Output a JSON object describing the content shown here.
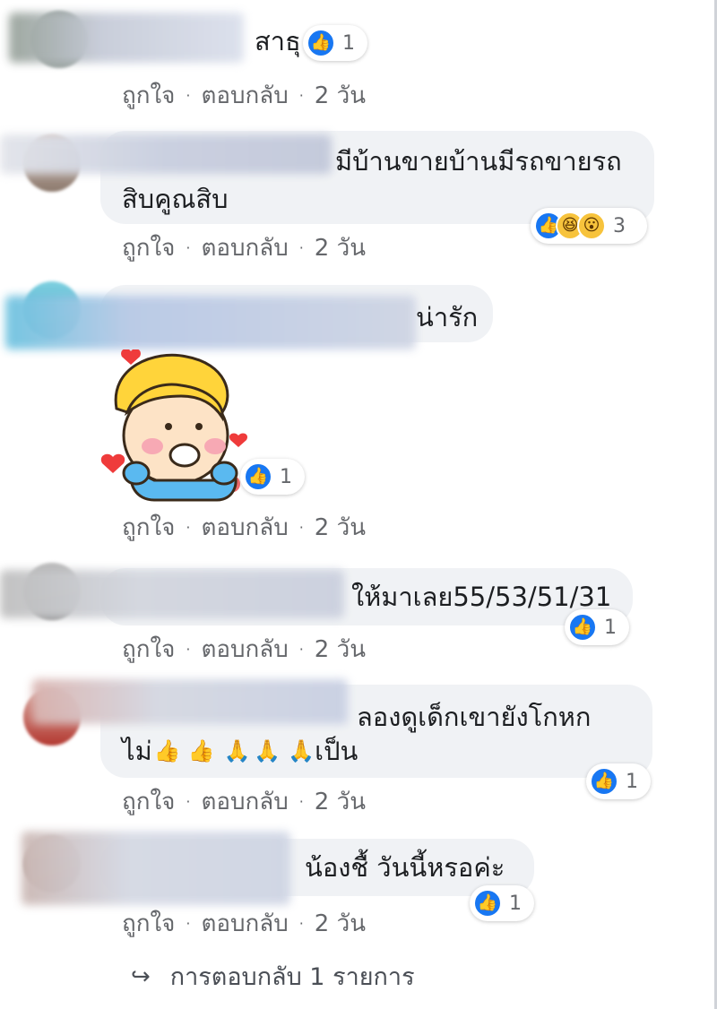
{
  "colors": {
    "bubble": "#f0f2f5",
    "like_blue": "#1877f2",
    "meta_gray": "#65676b"
  },
  "action_labels": {
    "like": "ถูกใจ",
    "separator": "·",
    "reply": "ตอบกลับ",
    "time": "2 วัน"
  },
  "comments": [
    {
      "text_lines": [
        "สาธุ"
      ],
      "reactions": {
        "icons": [
          "like-icon"
        ],
        "count": "1"
      }
    },
    {
      "text_lines": [
        "มีบ้านขายบ้านมีรถขายรถ",
        "สิบคูณสิบ"
      ],
      "reactions": {
        "icons": [
          "like-icon",
          "haha-icon",
          "wow-icon"
        ],
        "count": "3"
      }
    },
    {
      "text_lines": [
        "น่ารัก"
      ],
      "sticker": "boy-cheering-sticker",
      "reactions": {
        "icons": [
          "like-icon"
        ],
        "count": "1"
      }
    },
    {
      "text_lines": [
        "ให้มาเลย55/53/51/31"
      ],
      "reactions": {
        "icons": [
          "like-icon"
        ],
        "count": "1"
      }
    },
    {
      "text_lines": [
        "ลองดูเด็กเขายังโกหก",
        "ไม่",
        "เป็น"
      ],
      "emoji": [
        "thumbs-up",
        "thumbs-up",
        "praying-hands",
        "praying-hands",
        "praying-hands"
      ],
      "reactions": {
        "icons": [
          "like-icon"
        ],
        "count": "1"
      }
    },
    {
      "text_lines": [
        "น้องชื้ วันนี้หรอค่ะ"
      ],
      "reactions": {
        "icons": [
          "like-icon"
        ],
        "count": "1"
      }
    }
  ],
  "more_replies": {
    "label": "การตอบกลับ 1 รายการ",
    "icon": "reply-arrow-icon"
  }
}
